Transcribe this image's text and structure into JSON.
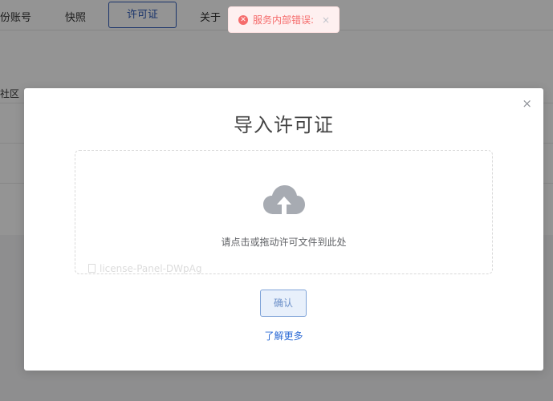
{
  "topnav": {
    "items": [
      {
        "label": "份账号"
      },
      {
        "label": "快照"
      },
      {
        "label": "许可证"
      },
      {
        "label": "关于"
      }
    ]
  },
  "background": {
    "label": "社区"
  },
  "toast": {
    "type": "error",
    "text": "服务内部错误:",
    "icon": "error-circle-icon",
    "close": "×",
    "color": "#f56c6c"
  },
  "dialog": {
    "title": "导入许可证",
    "close": "×",
    "upload": {
      "icon": "cloud-upload-icon",
      "text": "请点击或拖动许可文件到此处"
    },
    "file_name": "license-Panel-DWpAg",
    "confirm_label": "确认",
    "learn_more": "了解更多",
    "accent_color": "#2d6bd5"
  }
}
